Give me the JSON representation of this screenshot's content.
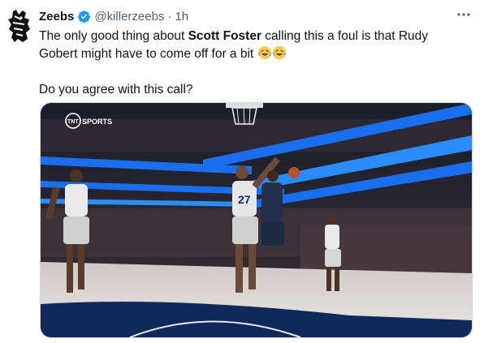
{
  "author": {
    "display_name": "Zeebs",
    "handle": "@killerzeebs",
    "separator": "·",
    "time": "1h",
    "verified": true,
    "avatar_icon": "zebra-logo-icon"
  },
  "tweet": {
    "line1_pre": "The only good thing about ",
    "line1_bold": "Scott Foster",
    "line1_post": " calling this a foul is that Rudy Gobert might have to come off for a bit",
    "emojis": [
      "laughing-tears-emoji",
      "laughing-tears-emoji"
    ],
    "line2": "Do you agree with this call?"
  },
  "media": {
    "broadcast_logo": "TNT SPORTS",
    "logo_letters": "TNT",
    "logo_word": "SPORTS",
    "jersey_number": "27",
    "description_icon": "basketball-photo"
  },
  "colors": {
    "verified": "#1d9bf0",
    "text": "#0f1419",
    "secondary": "#536471"
  },
  "more_icon": "more-dots-icon"
}
